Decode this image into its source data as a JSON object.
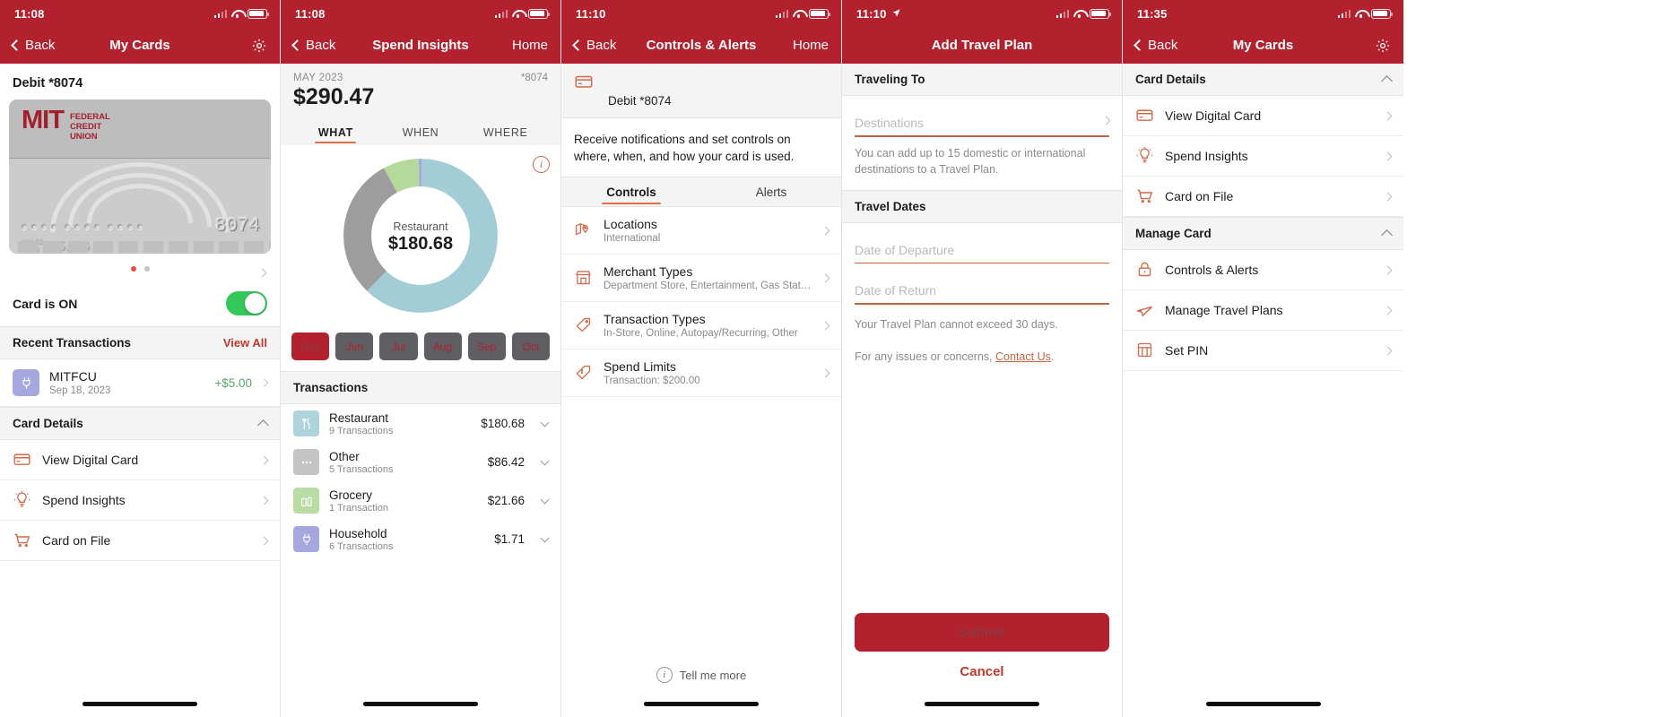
{
  "brand": {
    "red": "#b3202e",
    "accent": "#d2694a",
    "green": "#34c759",
    "link": "#c0392b"
  },
  "panel1": {
    "status": {
      "time": "11:08"
    },
    "nav": {
      "back": "Back",
      "title": "My Cards",
      "right_icon": "gear-icon"
    },
    "card_title": "Debit *8074",
    "card_art": {
      "bank_mark": "MIT",
      "bank_lines": [
        "FEDERAL",
        "CREDIT",
        "UNION"
      ],
      "masked_last4": "8074",
      "valid_label_line1": "VALID",
      "valid_label_line2": "THRU",
      "expiry": "05/26"
    },
    "card_state_label": "Card is ON",
    "card_state_on": true,
    "recent": {
      "header": "Recent Transactions",
      "view_all": "View All"
    },
    "transaction": {
      "merchant": "MITFCU",
      "date": "Sep 18, 2023",
      "amount": "+$5.00"
    },
    "details_header": "Card Details",
    "detail_rows": [
      {
        "label": "View Digital Card",
        "icon": "credit-card-icon"
      },
      {
        "label": "Spend Insights",
        "icon": "lightbulb-icon"
      },
      {
        "label": "Card on File",
        "icon": "shopping-cart-icon"
      }
    ]
  },
  "panel2": {
    "status": {
      "time": "11:08"
    },
    "nav": {
      "back": "Back",
      "title": "Spend Insights",
      "right": "Home"
    },
    "period": "MAY 2023",
    "total": "$290.47",
    "card_number": "*8074",
    "tabs": [
      {
        "label": "WHAT",
        "active": true
      },
      {
        "label": "WHEN",
        "active": false
      },
      {
        "label": "WHERE",
        "active": false
      }
    ],
    "donut_center_label": "Restaurant",
    "donut_center_value": "$180.68",
    "months": [
      {
        "label": "May",
        "active": true
      },
      {
        "label": "Jun",
        "active": false
      },
      {
        "label": "Jul",
        "active": false
      },
      {
        "label": "Aug",
        "active": false
      },
      {
        "label": "Sep",
        "active": false
      },
      {
        "label": "Oct",
        "active": false
      }
    ],
    "transactions_header": "Transactions",
    "transactions": [
      {
        "name": "Restaurant",
        "count": "9 Transactions",
        "amount": "$180.68",
        "icon": "cutlery-icon",
        "color": "#aed3dd"
      },
      {
        "name": "Other",
        "count": "5 Transactions",
        "amount": "$86.42",
        "icon": "ellipsis-icon",
        "color": "#c4c4c4"
      },
      {
        "name": "Grocery",
        "count": "1 Transaction",
        "amount": "$21.66",
        "icon": "groceries-icon",
        "color": "#b9dba4"
      },
      {
        "name": "Household",
        "count": "6 Transactions",
        "amount": "$1.71",
        "icon": "plug-icon",
        "color": "#a7a7e0"
      }
    ],
    "chart_data": {
      "type": "pie",
      "title": "Spend Insights MAY 2023",
      "categories": [
        "Restaurant",
        "Other",
        "Grocery",
        "Household"
      ],
      "values": [
        180.68,
        86.42,
        21.66,
        1.71
      ],
      "colors": [
        "#a2ccd6",
        "#9d9d9d",
        "#b3d99b",
        "#a7a7e0"
      ],
      "total": 290.47,
      "legend": "bottom-list",
      "grid": false
    }
  },
  "panel3": {
    "status": {
      "time": "11:10"
    },
    "nav": {
      "back": "Back",
      "title": "Controls & Alerts",
      "right": "Home"
    },
    "card_label": "Debit *8074",
    "description": "Receive notifications and set controls on where, when, and how your card is used.",
    "segments": [
      {
        "label": "Controls",
        "active": true
      },
      {
        "label": "Alerts",
        "active": false
      }
    ],
    "rows": [
      {
        "label": "Locations",
        "sub": "International",
        "icon": "map-pin-icon"
      },
      {
        "label": "Merchant Types",
        "sub": "Department Store, Entertainment, Gas Station,...",
        "icon": "storefront-icon"
      },
      {
        "label": "Transaction Types",
        "sub": "In-Store, Online, Autopay/Recurring, Other",
        "icon": "tag-icon"
      },
      {
        "label": "Spend Limits",
        "sub": "Transaction: $200.00",
        "icon": "dollar-tag-icon"
      }
    ],
    "tell_me_more": "Tell me more"
  },
  "panel4": {
    "status": {
      "time": "11:10",
      "location_arrow": true
    },
    "nav": {
      "title": "Add Travel Plan"
    },
    "section_traveling_to": "Traveling To",
    "destinations_placeholder": "Destinations",
    "destinations_hint": "You can add up to 15 domestic or international destinations to a Travel Plan.",
    "section_travel_dates": "Travel Dates",
    "departure_placeholder": "Date of Departure",
    "return_placeholder": "Date of Return",
    "duration_hint": "Your Travel Plan cannot exceed 30 days.",
    "contact_prefix": "For any issues or concerns, ",
    "contact_link": "Contact Us",
    "contact_suffix": ".",
    "submit_label": "Submit",
    "cancel_label": "Cancel"
  },
  "panel5": {
    "status": {
      "time": "11:35"
    },
    "nav": {
      "back": "Back",
      "title": "My Cards",
      "right_icon": "gear-icon"
    },
    "section_card_details": "Card Details",
    "card_details_rows": [
      {
        "label": "View Digital Card",
        "icon": "credit-card-icon"
      },
      {
        "label": "Spend Insights",
        "icon": "lightbulb-icon"
      },
      {
        "label": "Card on File",
        "icon": "shopping-cart-icon"
      }
    ],
    "section_manage_card": "Manage Card",
    "manage_card_rows": [
      {
        "label": "Controls & Alerts",
        "icon": "lock-icon"
      },
      {
        "label": "Manage Travel Plans",
        "icon": "airplane-icon"
      },
      {
        "label": "Set PIN",
        "icon": "keypad-icon"
      }
    ]
  }
}
